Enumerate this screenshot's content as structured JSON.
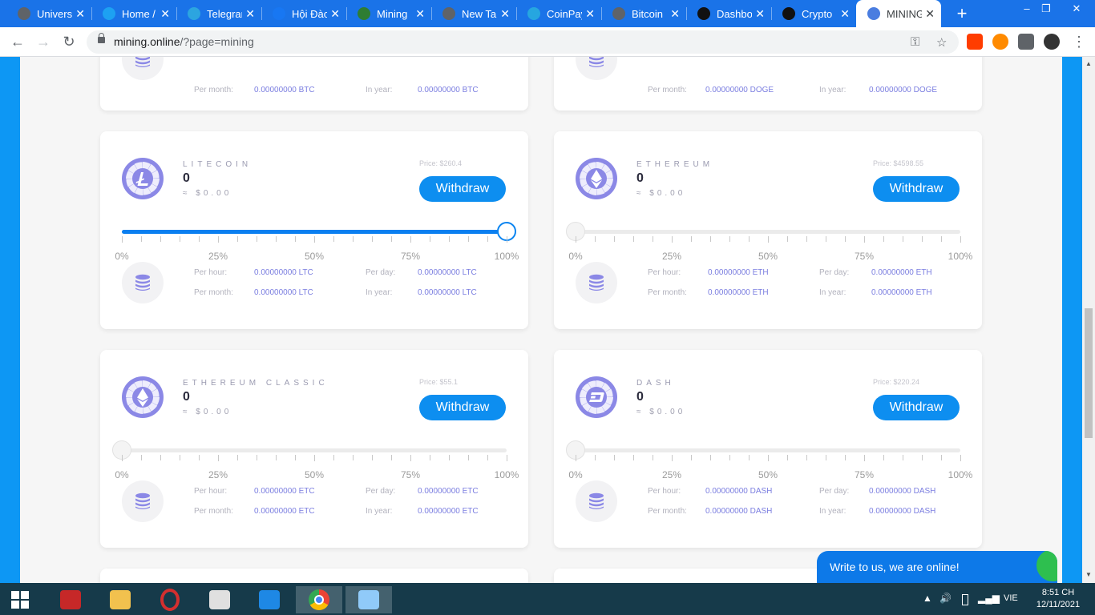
{
  "browser": {
    "tabs": [
      {
        "label": "Universal",
        "icon": "globe-icon",
        "color": "#5f6368"
      },
      {
        "label": "Home / Twitter",
        "icon": "twitter-icon",
        "color": "#1da1f2"
      },
      {
        "label": "Telegram",
        "icon": "telegram-icon",
        "color": "#2ca5e0"
      },
      {
        "label": "Hội Đào",
        "icon": "facebook-icon",
        "color": "#1877f2"
      },
      {
        "label": "Mining",
        "icon": "dollar-icon",
        "color": "#2e7d32"
      },
      {
        "label": "New Tab",
        "icon": "globe-icon",
        "color": "#5f6368"
      },
      {
        "label": "CoinPayments",
        "icon": "coinpayments-icon",
        "color": "#26a6e0"
      },
      {
        "label": "Bitcoin",
        "icon": "globe-icon",
        "color": "#5f6368"
      },
      {
        "label": "Dashboard",
        "icon": "f-logo-icon",
        "color": "#111111"
      },
      {
        "label": "Crypto",
        "icon": "cm-logo-icon",
        "color": "#111111"
      },
      {
        "label": "MINING",
        "icon": "cloud-icon",
        "color": "#4a7de0"
      }
    ],
    "new_tab": "+",
    "window_controls": {
      "minimize": "–",
      "maximize": "❐",
      "close": "✕"
    },
    "url_host": "mining.online",
    "url_path": "/?page=mining"
  },
  "cards": [
    {
      "name": "LITECOIN",
      "logo": "litecoin-icon",
      "balance": "0",
      "usd": "≈ $0.00",
      "price": "Price: $260.4",
      "withdraw": "Withdraw",
      "slider_percent": 100,
      "ticks": [
        "0%",
        "25%",
        "50%",
        "75%",
        "100%"
      ],
      "per_hour_label": "Per hour:",
      "per_hour": "0.00000000 LTC",
      "per_day_label": "Per day:",
      "per_day": "0.00000000 LTC",
      "per_month_label": "Per month:",
      "per_month": "0.00000000 LTC",
      "in_year_label": "In year:",
      "in_year": "0.00000000 LTC"
    },
    {
      "name": "ETHEREUM",
      "logo": "ethereum-icon",
      "balance": "0",
      "usd": "≈ $0.00",
      "price": "Price: $4598.55",
      "withdraw": "Withdraw",
      "slider_percent": 0,
      "ticks": [
        "0%",
        "25%",
        "50%",
        "75%",
        "100%"
      ],
      "per_hour_label": "Per hour:",
      "per_hour": "0.00000000 ETH",
      "per_day_label": "Per day:",
      "per_day": "0.00000000 ETH",
      "per_month_label": "Per month:",
      "per_month": "0.00000000 ETH",
      "in_year_label": "In year:",
      "in_year": "0.00000000 ETH"
    },
    {
      "name": "ETHEREUM CLASSIC",
      "logo": "ethereum-classic-icon",
      "balance": "0",
      "usd": "≈ $0.00",
      "price": "Price: $55.1",
      "withdraw": "Withdraw",
      "slider_percent": 0,
      "ticks": [
        "0%",
        "25%",
        "50%",
        "75%",
        "100%"
      ],
      "per_hour_label": "Per hour:",
      "per_hour": "0.00000000 ETC",
      "per_day_label": "Per day:",
      "per_day": "0.00000000 ETC",
      "per_month_label": "Per month:",
      "per_month": "0.00000000 ETC",
      "in_year_label": "In year:",
      "in_year": "0.00000000 ETC"
    },
    {
      "name": "DASH",
      "logo": "dash-icon",
      "balance": "0",
      "usd": "≈ $0.00",
      "price": "Price: $220.24",
      "withdraw": "Withdraw",
      "slider_percent": 0,
      "ticks": [
        "0%",
        "25%",
        "50%",
        "75%",
        "100%"
      ],
      "per_hour_label": "Per hour:",
      "per_hour": "0.00000000 DASH",
      "per_day_label": "Per day:",
      "per_day": "0.00000000 DASH",
      "per_month_label": "Per month:",
      "per_month": "0.00000000 DASH",
      "in_year_label": "In year:",
      "in_year": "0.00000000 DASH"
    }
  ],
  "top_cards": [
    {
      "per_month_label": "Per month:",
      "per_month": "0.00000000 BTC",
      "in_year_label": "In year:",
      "in_year": "0.00000000 BTC"
    },
    {
      "per_month_label": "Per month:",
      "per_month": "0.00000000 DOGE",
      "in_year_label": "In year:",
      "in_year": "0.00000000 DOGE"
    }
  ],
  "chat": {
    "text": "Write to us, we are online!"
  },
  "taskbar": {
    "apps": [
      "windows-start-icon",
      "garena-icon",
      "file-explorer-icon",
      "opera-icon",
      "snipping-tool-icon",
      "coccoc-icon",
      "chrome-icon",
      "notepad-icon"
    ],
    "lang": "VIE",
    "time": "8:51 CH",
    "date": "12/11/2021"
  },
  "colors": {
    "accent": "#0d8ef0",
    "page_bg": "#0d97f4",
    "coin_logo": "#8b88e6",
    "stat_value": "#7b7ee0"
  }
}
